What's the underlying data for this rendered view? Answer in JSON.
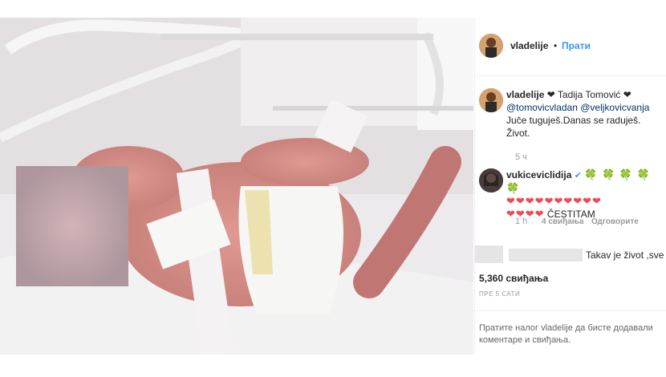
{
  "post": {
    "username": "vladelije",
    "separator": "•",
    "follow_label": "Прати"
  },
  "caption": {
    "username": "vladelije",
    "text_heart": "❤",
    "name_line": "Tadija Tomović",
    "mention1": "@tomovicvladan",
    "mention2": "@veljkovicvanja",
    "body": "Juče tuguješ.Danas se raduješ. Život.",
    "time": "5 ч"
  },
  "comment": {
    "username": "vukiceviclidija",
    "verified_icon": "✔",
    "clovers": "🍀 🍀 🍀 🍀 🍀",
    "hearts_row1": "❤❤❤❤❤❤❤❤❤❤",
    "hearts_row2": "❤❤❤❤",
    "text": "ČESTITAM",
    "time": "1 h",
    "likes": "4 свиђања",
    "reply_label": "Одговорите"
  },
  "blurred_comment": {
    "text": "Takav je život ,sve"
  },
  "likes_count": "5,360 свиђања",
  "posted_time": "ПРЕ 5 САТИ",
  "footer_notice": "Пратите налог vladelije да бисте додавали коментаре и свиђања."
}
